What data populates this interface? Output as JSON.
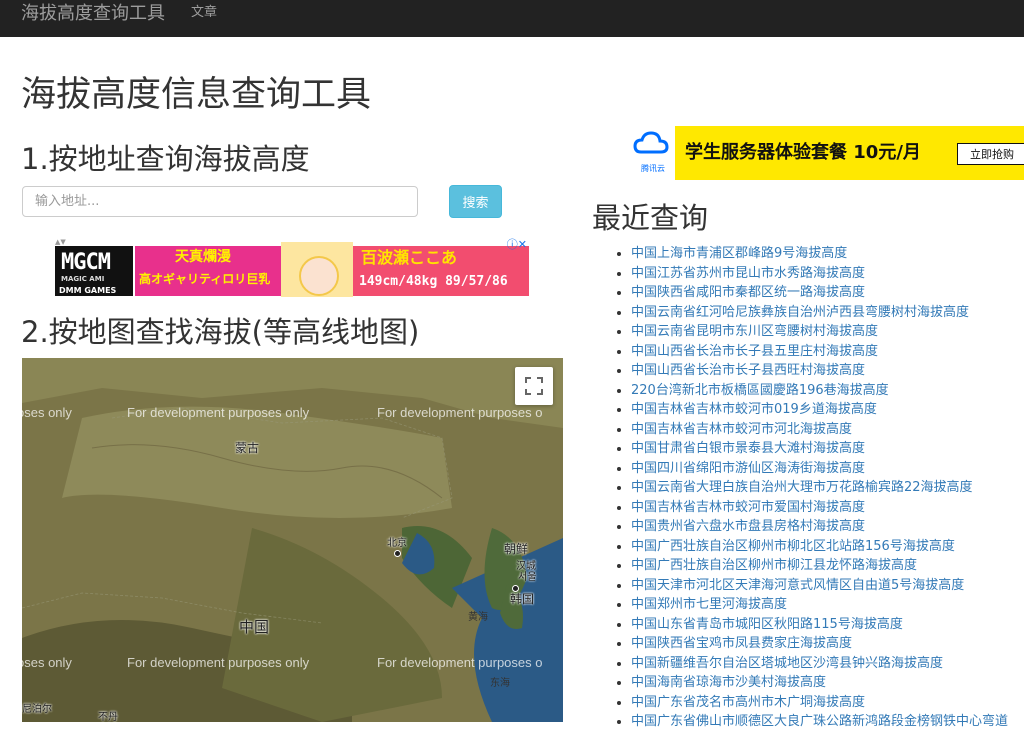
{
  "navbar": {
    "brand": "海拔高度查询工具",
    "links": [
      "文章"
    ]
  },
  "page_title": "海拔高度信息查询工具",
  "address_section": {
    "title": "1.按地址查询海拔高度",
    "input_placeholder": "输入地址...",
    "input_value": "",
    "search_label": "搜索"
  },
  "ad_left": {
    "logo": "MGCM",
    "logo_sub": "MAGIC AMI",
    "logo_brand": "DMM GAMES",
    "line1": "天真爛漫",
    "line2": "高オギャリティロリ巨乳",
    "line3": "百波瀬ここあ",
    "line4": "149cm/48kg 89/57/86"
  },
  "map_section": {
    "title": "2.按地图查找海拔(等高线地图)",
    "watermark": "For development purposes only",
    "watermark_partial_left": "oses only",
    "watermark_partial_right": "For development purposes o",
    "labels": {
      "mongolia": "蒙古",
      "beijing": "北京",
      "china": "中国",
      "north_korea": "朝鲜",
      "hanseong": "汉城",
      "seoul": "서울",
      "south_korea": "韩国",
      "yellow_sea": "黄海",
      "east_sea": "东海",
      "nepal": "尼泊尔",
      "bhutan": "不丹"
    },
    "colors": {
      "land": "#7b7548",
      "sea": "#2b5a86"
    }
  },
  "ad_right": {
    "brand": "腾讯云",
    "headline": "学生服务器体验套餐 10元/月",
    "button": "立即抢购"
  },
  "recent": {
    "title": "最近查询",
    "items": [
      "中国上海市青浦区郡峰路9号海拔高度",
      "中国江苏省苏州市昆山市水秀路海拔高度",
      "中国陕西省咸阳市秦都区统一路海拔高度",
      "中国云南省红河哈尼族彝族自治州泸西县弯腰树村海拔高度",
      "中国云南省昆明市东川区弯腰树村海拔高度",
      "中国山西省长治市长子县五里庄村海拔高度",
      "中国山西省长治市长子县西旺村海拔高度",
      "220台湾新北市板橋區國慶路196巷海拔高度",
      "中国吉林省吉林市蛟河市019乡道海拔高度",
      "中国吉林省吉林市蛟河市河北海拔高度",
      "中国甘肃省白银市景泰县大滩村海拔高度",
      "中国四川省绵阳市游仙区海涛街海拔高度",
      "中国云南省大理白族自治州大理市万花路榆宾路22海拔高度",
      "中国吉林省吉林市蛟河市爱国村海拔高度",
      "中国贵州省六盘水市盘县房格村海拔高度",
      "中国广西壮族自治区柳州市柳北区北站路156号海拔高度",
      "中国广西壮族自治区柳州市柳江县龙怀路海拔高度",
      "中国天津市河北区天津海河意式风情区自由道5号海拔高度",
      "中国郑州市七里河海拔高度",
      "中国山东省青岛市城阳区秋阳路115号海拔高度",
      "中国陕西省宝鸡市凤县费家庄海拔高度",
      "中国新疆维吾尔自治区塔城地区沙湾县钟兴路海拔高度",
      "中国海南省琼海市沙美村海拔高度",
      "中国广东省茂名市高州市木广垌海拔高度",
      "中国广东省佛山市顺德区大良广珠公路新鸿路段金榜钢铁中心弯道"
    ]
  }
}
